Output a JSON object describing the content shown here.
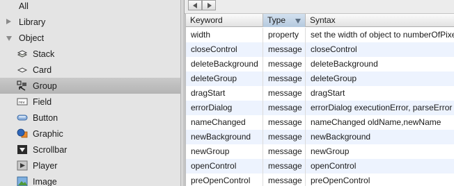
{
  "sidebar": {
    "items": [
      {
        "label": "All",
        "icon": "none",
        "disclosure": "none",
        "selected": false
      },
      {
        "label": "Library",
        "icon": "none",
        "disclosure": "collapsed",
        "selected": false
      },
      {
        "label": "Object",
        "icon": "none",
        "disclosure": "expanded",
        "selected": false
      },
      {
        "label": "Stack",
        "icon": "stack-icon",
        "disclosure": "none",
        "selected": false
      },
      {
        "label": "Card",
        "icon": "card-icon",
        "disclosure": "none",
        "selected": false
      },
      {
        "label": "Group",
        "icon": "group-icon",
        "disclosure": "none",
        "selected": true
      },
      {
        "label": "Field",
        "icon": "field-icon",
        "disclosure": "none",
        "selected": false
      },
      {
        "label": "Button",
        "icon": "button-icon",
        "disclosure": "none",
        "selected": false
      },
      {
        "label": "Graphic",
        "icon": "graphic-icon",
        "disclosure": "none",
        "selected": false
      },
      {
        "label": "Scrollbar",
        "icon": "scrollbar-icon",
        "disclosure": "none",
        "selected": false
      },
      {
        "label": "Player",
        "icon": "player-icon",
        "disclosure": "none",
        "selected": false
      },
      {
        "label": "Image",
        "icon": "image-icon",
        "disclosure": "none",
        "selected": false
      }
    ]
  },
  "nav": {
    "prev_icon": "back-arrow-icon",
    "next_icon": "forward-arrow-icon"
  },
  "table": {
    "columns": [
      {
        "label": "Keyword",
        "sorted": false
      },
      {
        "label": "Type",
        "sorted": true
      },
      {
        "label": "Syntax",
        "sorted": false
      }
    ],
    "rows": [
      {
        "keyword": "width",
        "type": "property",
        "syntax": "set the width of object to numberOfPixels"
      },
      {
        "keyword": "closeControl",
        "type": "message",
        "syntax": "closeControl"
      },
      {
        "keyword": "deleteBackground",
        "type": "message",
        "syntax": "deleteBackground"
      },
      {
        "keyword": "deleteGroup",
        "type": "message",
        "syntax": "deleteGroup"
      },
      {
        "keyword": "dragStart",
        "type": "message",
        "syntax": "dragStart"
      },
      {
        "keyword": "errorDialog",
        "type": "message",
        "syntax": "errorDialog executionError, parseError"
      },
      {
        "keyword": "nameChanged",
        "type": "message",
        "syntax": "nameChanged oldName,newName"
      },
      {
        "keyword": "newBackground",
        "type": "message",
        "syntax": "newBackground"
      },
      {
        "keyword": "newGroup",
        "type": "message",
        "syntax": "newGroup"
      },
      {
        "keyword": "openControl",
        "type": "message",
        "syntax": "openControl"
      },
      {
        "keyword": "preOpenControl",
        "type": "message",
        "syntax": "preOpenControl"
      }
    ]
  },
  "colors": {
    "selection": "#bdbdbd",
    "header_sorted": "#c4d4e6",
    "row_alt": "#edf3fe"
  }
}
